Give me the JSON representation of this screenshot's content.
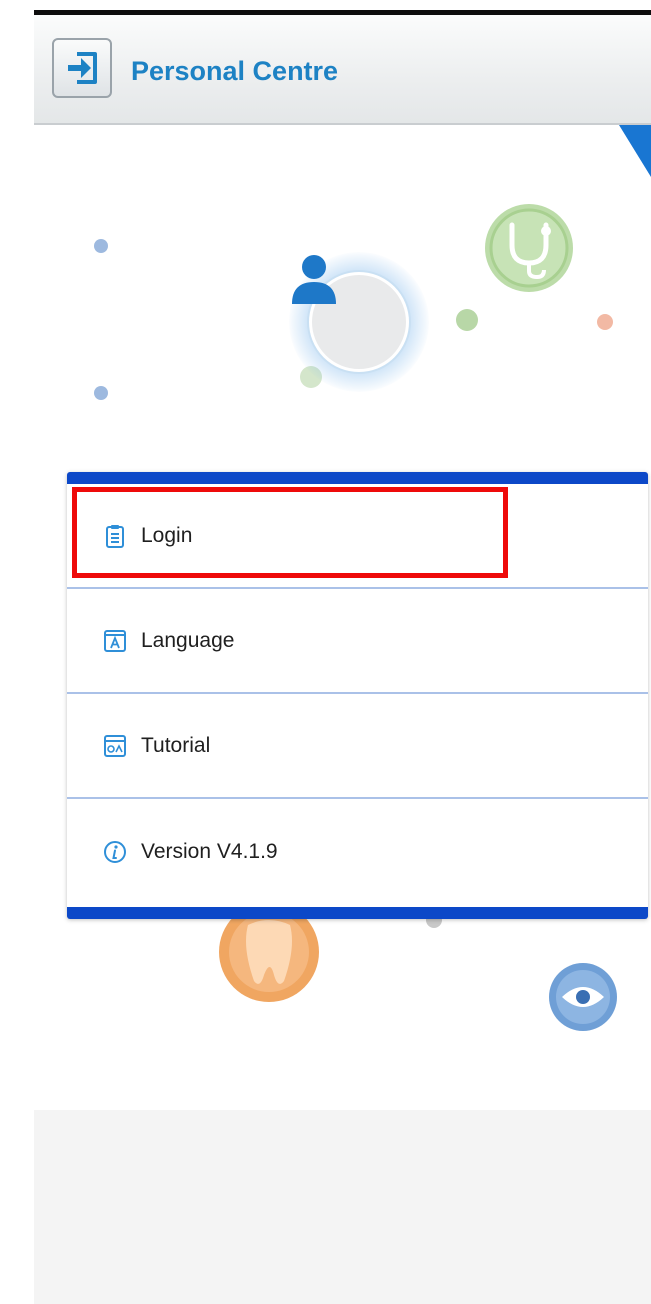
{
  "header": {
    "title": "Personal Centre",
    "back_icon": "exit-door-icon"
  },
  "avatar": {
    "icon": "user-icon"
  },
  "menu": {
    "items": [
      {
        "label": "Login",
        "icon": "clipboard-icon"
      },
      {
        "label": "Language",
        "icon": "language-icon"
      },
      {
        "label": "Tutorial",
        "icon": "tutorial-icon"
      },
      {
        "label": "Version V4.1.9",
        "icon": "info-icon"
      }
    ]
  },
  "colors": {
    "accent_blue": "#1d82c4",
    "card_border": "#0c48c8",
    "highlight_red": "#ee0a0a",
    "icon_blue": "#2f8fd8"
  }
}
